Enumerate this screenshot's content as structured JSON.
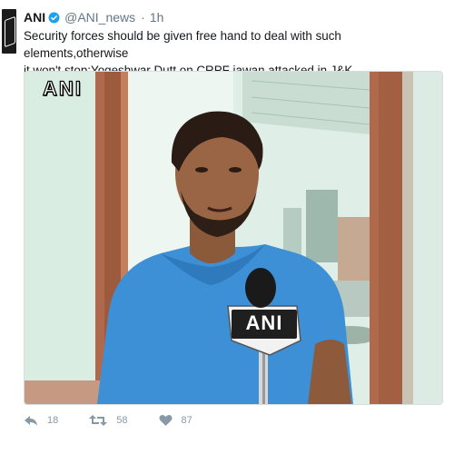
{
  "tweet": {
    "author_name": "ANI",
    "handle": "@ANI_news",
    "separator": "·",
    "time": "1h",
    "text_line1": "Security forces should be given free hand to deal with such elements,otherwise",
    "text_line2": "it won't stop:Yogeshwar Dutt on CRPF jawan attacked in J&K",
    "media": {
      "watermark": "ANI",
      "mic_label": "ANI"
    },
    "actions": {
      "reply_icon": "reply-icon",
      "reply_count": "18",
      "retweet_icon": "retweet-icon",
      "retweet_count": "58",
      "like_icon": "heart-icon",
      "like_count": "87"
    },
    "colors": {
      "text": "#14171a",
      "muted": "#657786",
      "verified": "#1da1f2",
      "shirt": "#3d8fd6"
    }
  }
}
